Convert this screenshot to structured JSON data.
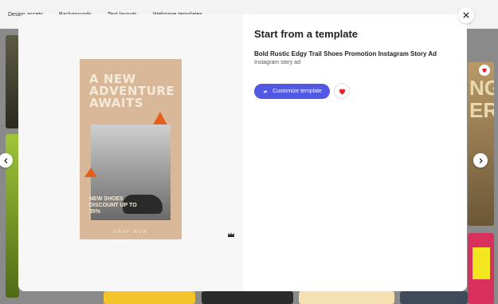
{
  "topnav": {
    "items": [
      "Design assets",
      "Backgrounds",
      "Text layouts",
      "Webpage templates"
    ]
  },
  "modal": {
    "title": "Start from a template",
    "template_name": "Bold Rustic Edgy Trail Shoes Promotion Instagram Story Ad",
    "template_type": "Instagram story ad",
    "customize_label": "Customize template"
  },
  "poster": {
    "headline": "A NEW ADVENTURE AWAITS",
    "promo": "NEW SHOES DISCOUNT UP TO 35%",
    "footer": "SHOP NOW"
  },
  "background_cards": {
    "right_text": "NG ER"
  },
  "icons": {
    "close": "close-icon",
    "prev": "chevron-left-icon",
    "next": "chevron-right-icon",
    "customize": "link-icon",
    "favorite": "heart-icon",
    "premium": "crown-icon"
  },
  "colors": {
    "accent": "#5258e4",
    "heart": "#e3262d",
    "poster_orange": "#e5601d"
  }
}
